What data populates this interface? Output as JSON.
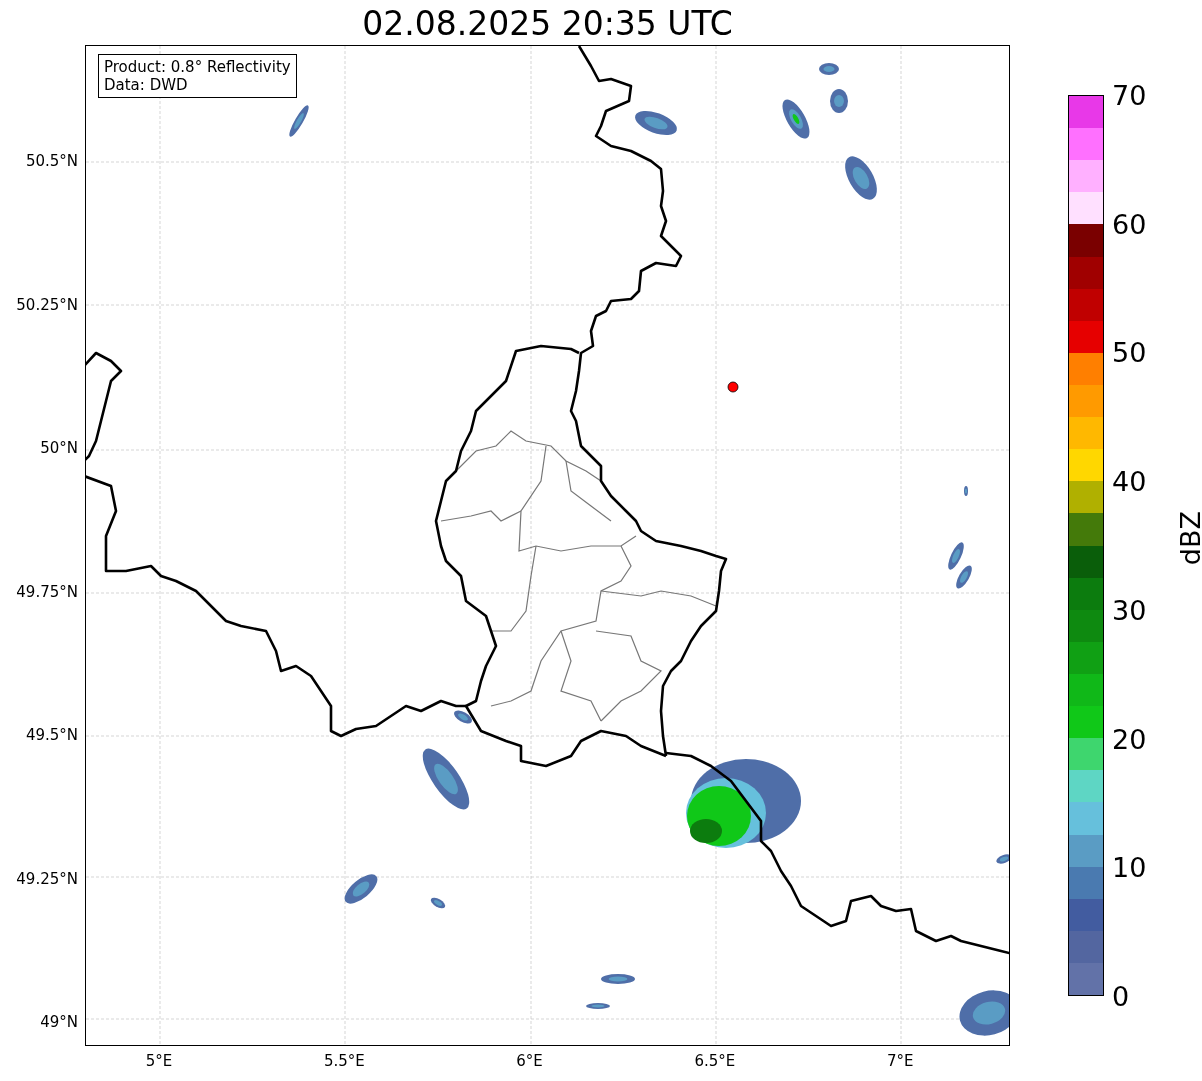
{
  "title": "02.08.2025 20:35 UTC",
  "info_box": [
    "Product: 0.8° Reflectivity",
    "Data: DWD"
  ],
  "map": {
    "lat_ticks": [
      "50.5°N",
      "50.25°N",
      "50°N",
      "49.75°N",
      "49.5°N",
      "49.25°N",
      "49°N"
    ],
    "lon_ticks": [
      "5°E",
      "5.5°E",
      "6°E",
      "6.5°E",
      "7°E"
    ]
  },
  "colorbar": {
    "label": "dBZ",
    "ticks": [
      "70",
      "60",
      "50",
      "40",
      "30",
      "20",
      "10",
      "0"
    ],
    "segments": [
      {
        "color": "#e838e8"
      },
      {
        "color": "#ff70ff"
      },
      {
        "color": "#ffb0ff"
      },
      {
        "color": "#ffe0ff"
      },
      {
        "color": "#7a0000"
      },
      {
        "color": "#a00000"
      },
      {
        "color": "#c00000"
      },
      {
        "color": "#e60000"
      },
      {
        "color": "#ff7f00"
      },
      {
        "color": "#ff9a00"
      },
      {
        "color": "#ffb800"
      },
      {
        "color": "#ffd700"
      },
      {
        "color": "#b0b000"
      },
      {
        "color": "#447a0a"
      },
      {
        "color": "#0a5e0a"
      },
      {
        "color": "#0c7c0e"
      },
      {
        "color": "#0e8a10"
      },
      {
        "color": "#10a014"
      },
      {
        "color": "#10b818"
      },
      {
        "color": "#10c818"
      },
      {
        "color": "#3ed66e"
      },
      {
        "color": "#5ed6c4"
      },
      {
        "color": "#66c0dc"
      },
      {
        "color": "#5a9cc4"
      },
      {
        "color": "#4a7ab0"
      },
      {
        "color": "#425ca0"
      },
      {
        "color": "#5366a0"
      },
      {
        "color": "#6272a8"
      }
    ]
  }
}
